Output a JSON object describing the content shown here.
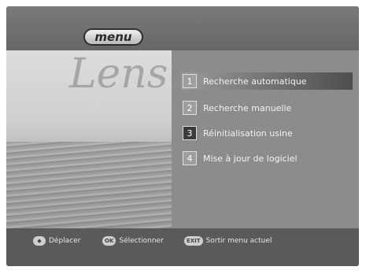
{
  "header": {
    "title": "menu"
  },
  "background": {
    "watermark": "Lens"
  },
  "menu": {
    "items": [
      {
        "number": "1",
        "label": "Recherche automatique"
      },
      {
        "number": "2",
        "label": "Recherche manuelle"
      },
      {
        "number": "3",
        "label": "Réinitialisation usine"
      },
      {
        "number": "4",
        "label": "Mise à jour de logiciel"
      }
    ]
  },
  "footer": {
    "hints": [
      {
        "key": "◆",
        "label": "Déplacer"
      },
      {
        "key": "OK",
        "label": "Sélectionner"
      },
      {
        "key": "EXIT",
        "label": "Sortir menu actuel"
      }
    ]
  }
}
